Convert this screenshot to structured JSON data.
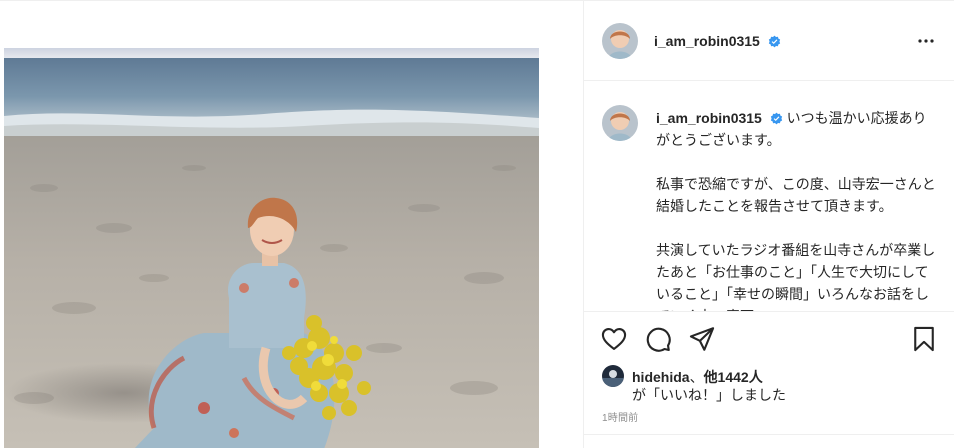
{
  "post": {
    "username": "i_am_robin0315",
    "verified": true,
    "caption_paragraphs": [
      "いつも温かい応援ありがとうございます。",
      "私事で恐縮ですが、この度、山寺宏一さんと結婚したことを報告させて頂きます。",
      "共演していたラジオ番組を山寺さんが卒業したあと「お仕事のこと」「人生で大切にしていること」「幸せの瞬間」いろんなお話をしていく中、真面"
    ],
    "likes": {
      "liker": "hidehida",
      "separator": "、",
      "others_label": "他1442人",
      "suffix": "が「いいね！」しました"
    },
    "timestamp": "1時間前"
  },
  "icons": {
    "more": "more-horizontal-icon",
    "like": "heart-icon",
    "comment": "comment-icon",
    "share": "send-icon",
    "save": "bookmark-icon",
    "verified": "verified-badge-icon"
  },
  "colors": {
    "verified_blue": "#3897f0",
    "text": "#262626",
    "muted": "#8e8e8e",
    "border": "#efefef"
  }
}
